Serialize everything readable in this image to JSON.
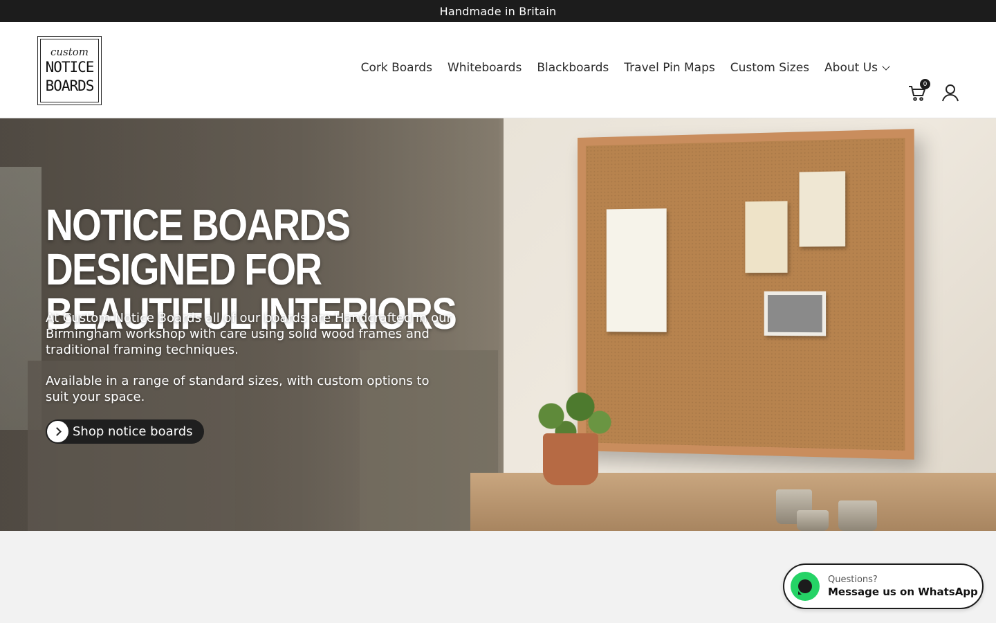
{
  "announcement": {
    "text": "Handmade in Britain"
  },
  "logo": {
    "script": "custom",
    "line1": "NOTICE",
    "line2": "BOARDS"
  },
  "nav": {
    "items": [
      {
        "label": "Cork Boards"
      },
      {
        "label": "Whiteboards"
      },
      {
        "label": "Blackboards"
      },
      {
        "label": "Travel Pin Maps"
      },
      {
        "label": "Custom Sizes"
      },
      {
        "label": "About Us",
        "has_dropdown": true
      }
    ]
  },
  "header_icons": {
    "cart_icon": "cart-icon",
    "cart_count": "0",
    "account_icon": "user-icon"
  },
  "hero": {
    "title_line1": "NOTICE BOARDS DESIGNED FOR",
    "title_line2": "BEAUTIFUL INTERIORS",
    "paragraph1": "At Custom Notice Boards all of our boards are Handcrafted in our Birmingham workshop with care using solid wood frames and traditional framing techniques.",
    "paragraph2": "Available in a range of standard sizes, with custom options to suit your space.",
    "cta_label": "Shop notice boards",
    "cta_icon": "chevron-right-icon"
  },
  "whatsapp": {
    "small": "Questions?",
    "big": "Message us on WhatsApp",
    "icon": "whatsapp-icon",
    "color": "#25d366"
  }
}
